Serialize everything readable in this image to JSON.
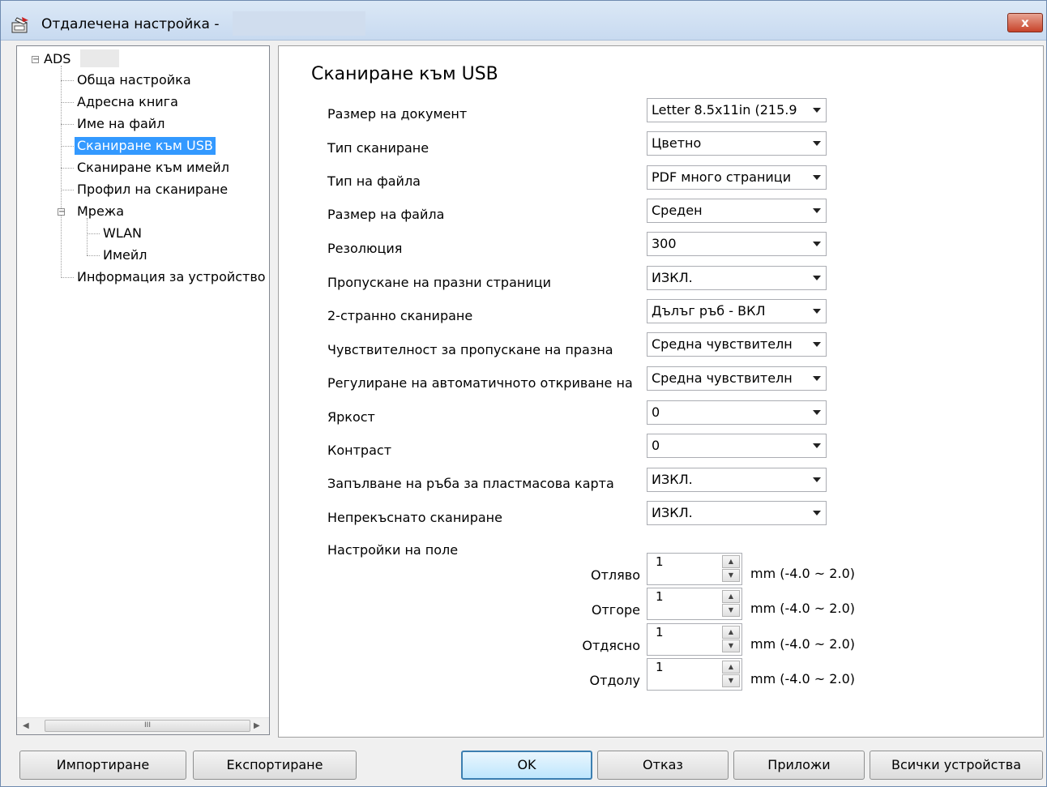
{
  "window": {
    "title": "Отдалечена настройка -",
    "close_label": "x"
  },
  "tree": {
    "root": "ADS",
    "items": [
      "Обща настройка",
      "Адресна книга",
      "Име на файл",
      "Сканиране към USB",
      "Сканиране към имейл",
      "Профил на сканиране"
    ],
    "network": {
      "label": "Мрежа",
      "children": [
        "WLAN",
        "Имейл"
      ]
    },
    "device_info": "Информация за устройство",
    "selected": "Сканиране към USB",
    "scroll_thumb": "III"
  },
  "main": {
    "heading": "Сканиране към USB",
    "settings": [
      {
        "label": "Размер на документ",
        "value": "Letter 8.5x11in (215.9"
      },
      {
        "label": "Тип сканиране",
        "value": "Цветно"
      },
      {
        "label": "Тип на файла",
        "value": "PDF много страници"
      },
      {
        "label": "Размер на файла",
        "value": "Среден"
      },
      {
        "label": "Резолюция",
        "value": "300"
      },
      {
        "label": "Пропускане на празни страници",
        "value": "ИЗКЛ."
      },
      {
        "label": "2-странно сканиране",
        "value": "Дълъг ръб - ВКЛ"
      },
      {
        "label": "Чувствителност за пропускане на празна",
        "value": "Средна чувствителн"
      },
      {
        "label": "Регулиране на автоматичното откриване на",
        "value": "Средна чувствителн"
      },
      {
        "label": "Яркост",
        "value": "0"
      },
      {
        "label": "Контраст",
        "value": "0"
      },
      {
        "label": "Запълване на ръба за пластмасова карта",
        "value": "ИЗКЛ."
      },
      {
        "label": "Непрекъснато сканиране",
        "value": "ИЗКЛ."
      }
    ],
    "margin_title": "Настройки на поле",
    "margins": [
      {
        "label": "Отляво",
        "value": "1",
        "unit": "mm (-4.0 ~ 2.0)"
      },
      {
        "label": "Отгоре",
        "value": "1",
        "unit": "mm (-4.0 ~ 2.0)"
      },
      {
        "label": "Отдясно",
        "value": "1",
        "unit": "mm (-4.0 ~ 2.0)"
      },
      {
        "label": "Отдолу",
        "value": "1",
        "unit": "mm (-4.0 ~ 2.0)"
      }
    ]
  },
  "buttons": {
    "import": "Импортиране",
    "export": "Експортиране",
    "ok": "OK",
    "cancel": "Отказ",
    "apply": "Приложи",
    "all_devices": "Всички устройства"
  }
}
